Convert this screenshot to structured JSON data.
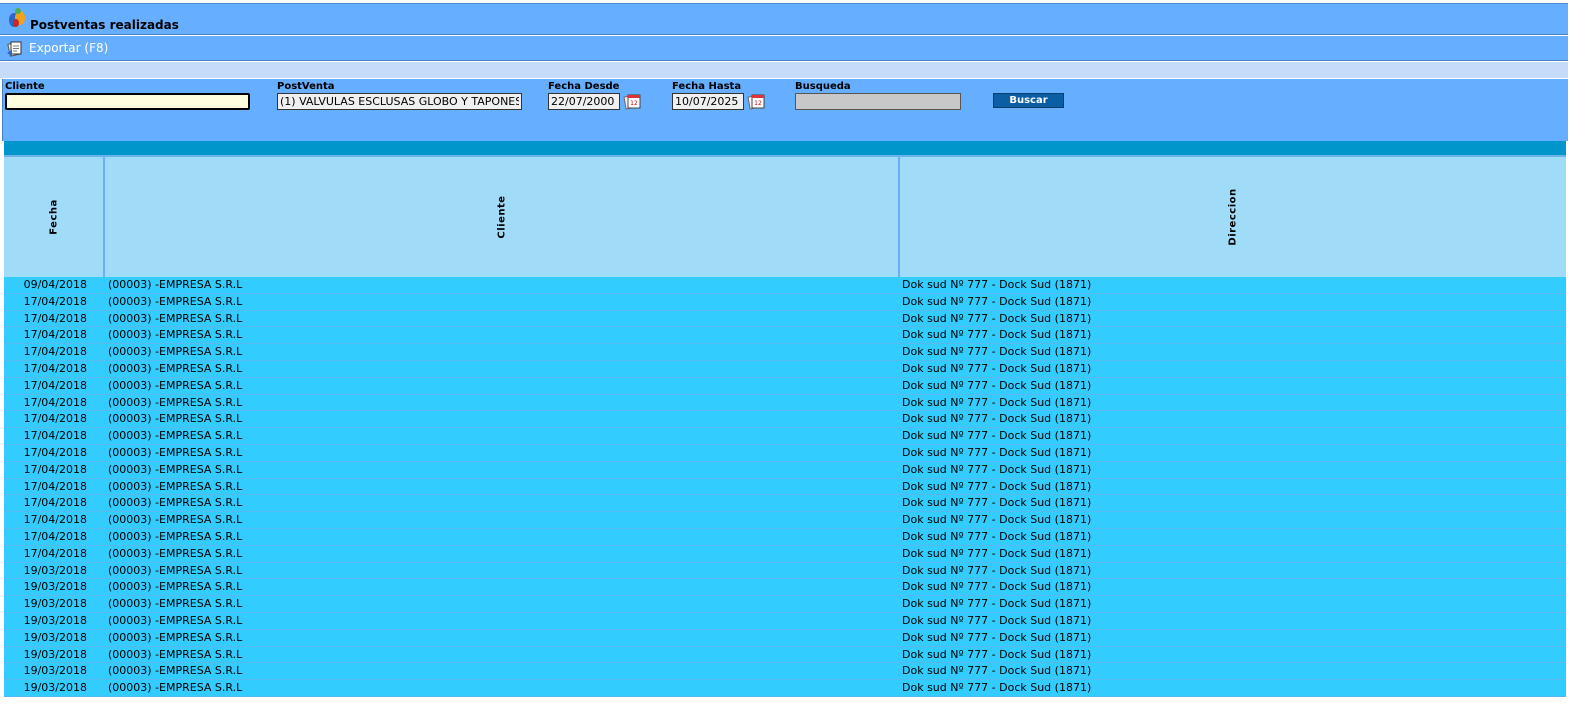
{
  "window": {
    "title": "Postventas realizadas"
  },
  "toolbar": {
    "export_label": "Exportar (F8)"
  },
  "filters": {
    "cliente": {
      "label": "Cliente",
      "value": ""
    },
    "postventa": {
      "label": "PostVenta",
      "value": "(1) VALVULAS ESCLUSAS GLOBO Y TAPONES"
    },
    "fecha_desde": {
      "label": "Fecha Desde",
      "value": "22/07/2000"
    },
    "fecha_hasta": {
      "label": "Fecha Hasta",
      "value": "10/07/2025"
    },
    "busqueda": {
      "label": "Busqueda",
      "value": ""
    },
    "buscar_label": "Buscar"
  },
  "table": {
    "headers": [
      "Fecha",
      "Cliente",
      "Direccion"
    ],
    "rows": [
      {
        "fecha": "09/04/2018",
        "cliente": "(00003) -EMPRESA S.R.L",
        "direccion": "Dok sud Nº 777 - Dock Sud (1871)"
      },
      {
        "fecha": "17/04/2018",
        "cliente": "(00003) -EMPRESA S.R.L",
        "direccion": "Dok sud Nº 777 - Dock Sud (1871)"
      },
      {
        "fecha": "17/04/2018",
        "cliente": "(00003) -EMPRESA S.R.L",
        "direccion": "Dok sud Nº 777 - Dock Sud (1871)"
      },
      {
        "fecha": "17/04/2018",
        "cliente": "(00003) -EMPRESA S.R.L",
        "direccion": "Dok sud Nº 777 - Dock Sud (1871)"
      },
      {
        "fecha": "17/04/2018",
        "cliente": "(00003) -EMPRESA S.R.L",
        "direccion": "Dok sud Nº 777 - Dock Sud (1871)"
      },
      {
        "fecha": "17/04/2018",
        "cliente": "(00003) -EMPRESA S.R.L",
        "direccion": "Dok sud Nº 777 - Dock Sud (1871)"
      },
      {
        "fecha": "17/04/2018",
        "cliente": "(00003) -EMPRESA S.R.L",
        "direccion": "Dok sud Nº 777 - Dock Sud (1871)"
      },
      {
        "fecha": "17/04/2018",
        "cliente": "(00003) -EMPRESA S.R.L",
        "direccion": "Dok sud Nº 777 - Dock Sud (1871)"
      },
      {
        "fecha": "17/04/2018",
        "cliente": "(00003) -EMPRESA S.R.L",
        "direccion": "Dok sud Nº 777 - Dock Sud (1871)"
      },
      {
        "fecha": "17/04/2018",
        "cliente": "(00003) -EMPRESA S.R.L",
        "direccion": "Dok sud Nº 777 - Dock Sud (1871)"
      },
      {
        "fecha": "17/04/2018",
        "cliente": "(00003) -EMPRESA S.R.L",
        "direccion": "Dok sud Nº 777 - Dock Sud (1871)"
      },
      {
        "fecha": "17/04/2018",
        "cliente": "(00003) -EMPRESA S.R.L",
        "direccion": "Dok sud Nº 777 - Dock Sud (1871)"
      },
      {
        "fecha": "17/04/2018",
        "cliente": "(00003) -EMPRESA S.R.L",
        "direccion": "Dok sud Nº 777 - Dock Sud (1871)"
      },
      {
        "fecha": "17/04/2018",
        "cliente": "(00003) -EMPRESA S.R.L",
        "direccion": "Dok sud Nº 777 - Dock Sud (1871)"
      },
      {
        "fecha": "17/04/2018",
        "cliente": "(00003) -EMPRESA S.R.L",
        "direccion": "Dok sud Nº 777 - Dock Sud (1871)"
      },
      {
        "fecha": "17/04/2018",
        "cliente": "(00003) -EMPRESA S.R.L",
        "direccion": "Dok sud Nº 777 - Dock Sud (1871)"
      },
      {
        "fecha": "17/04/2018",
        "cliente": "(00003) -EMPRESA S.R.L",
        "direccion": "Dok sud Nº 777 - Dock Sud (1871)"
      },
      {
        "fecha": "19/03/2018",
        "cliente": "(00003) -EMPRESA S.R.L",
        "direccion": "Dok sud Nº 777 - Dock Sud (1871)"
      },
      {
        "fecha": "19/03/2018",
        "cliente": "(00003) -EMPRESA S.R.L",
        "direccion": "Dok sud Nº 777 - Dock Sud (1871)"
      },
      {
        "fecha": "19/03/2018",
        "cliente": "(00003) -EMPRESA S.R.L",
        "direccion": "Dok sud Nº 777 - Dock Sud (1871)"
      },
      {
        "fecha": "19/03/2018",
        "cliente": "(00003) -EMPRESA S.R.L",
        "direccion": "Dok sud Nº 777 - Dock Sud (1871)"
      },
      {
        "fecha": "19/03/2018",
        "cliente": "(00003) -EMPRESA S.R.L",
        "direccion": "Dok sud Nº 777 - Dock Sud (1871)"
      },
      {
        "fecha": "19/03/2018",
        "cliente": "(00003) -EMPRESA S.R.L",
        "direccion": "Dok sud Nº 777 - Dock Sud (1871)"
      },
      {
        "fecha": "19/03/2018",
        "cliente": "(00003) -EMPRESA S.R.L",
        "direccion": "Dok sud Nº 777 - Dock Sud (1871)"
      },
      {
        "fecha": "19/03/2018",
        "cliente": "(00003) -EMPRESA S.R.L",
        "direccion": "Dok sud Nº 777 - Dock Sud (1871)"
      }
    ]
  },
  "colors": {
    "header_bar": "#66aeff",
    "grid_header": "#a0dbf7",
    "grid_rows": "#33ccff",
    "button": "#0b5ea3",
    "cliente_input": "#ffffe0"
  },
  "icons": {
    "app": "app-logo-icon",
    "export": "export-icon",
    "calendar": "calendar-icon"
  }
}
